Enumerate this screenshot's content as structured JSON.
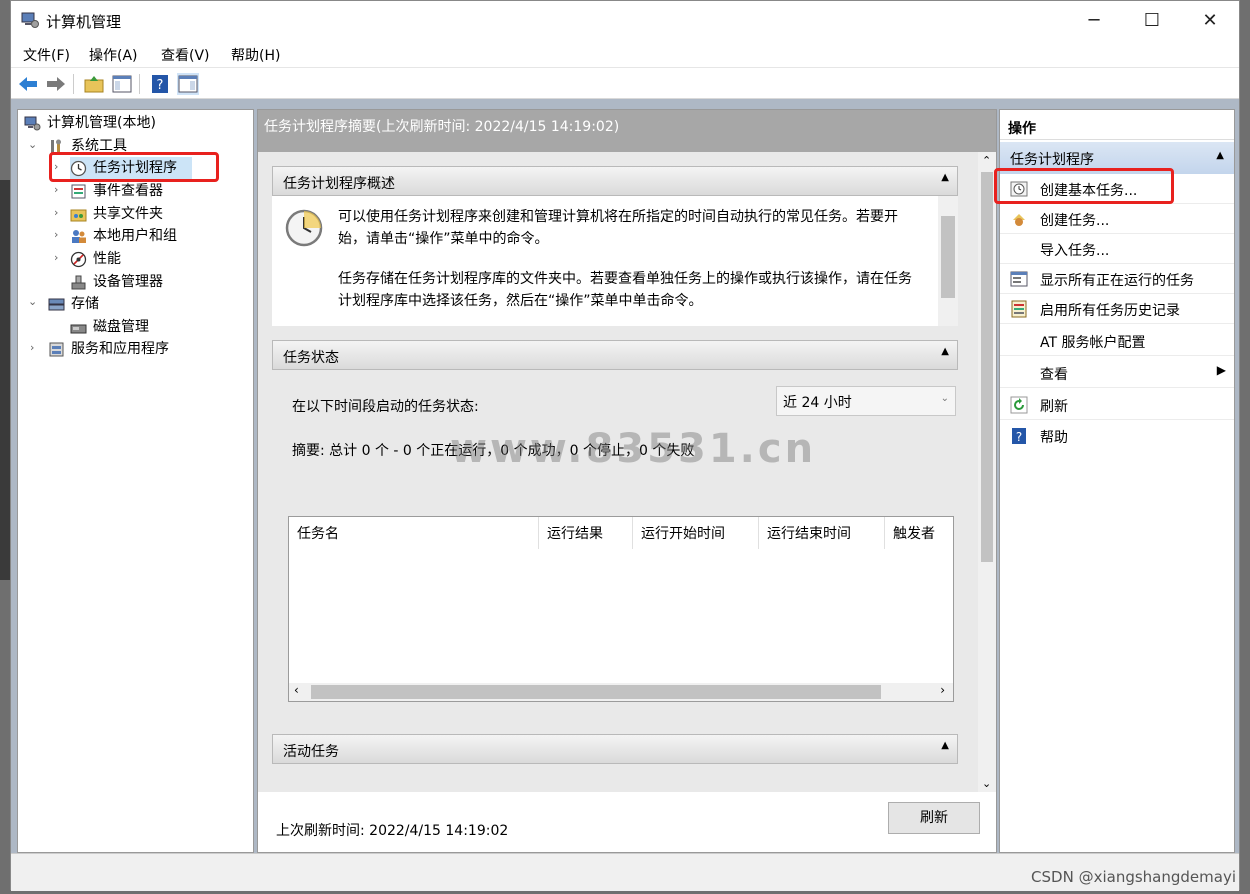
{
  "window": {
    "title": "计算机管理"
  },
  "menubar": {
    "file": "文件(F)",
    "action": "操作(A)",
    "view": "查看(V)",
    "help": "帮助(H)"
  },
  "tree": {
    "root": "计算机管理(本地)",
    "system_tools": "系统工具",
    "task_scheduler": "任务计划程序",
    "event_viewer": "事件查看器",
    "shared_folders": "共享文件夹",
    "local_users": "本地用户和组",
    "performance": "性能",
    "device_manager": "设备管理器",
    "storage": "存储",
    "disk_management": "磁盘管理",
    "services_apps": "服务和应用程序"
  },
  "center": {
    "header": "任务计划程序摘要(上次刷新时间: 2022/4/15 14:19:02)",
    "overview": {
      "title": "任务计划程序概述",
      "para1": "可以使用任务计划程序来创建和管理计算机将在所指定的时间自动执行的常见任务。若要开始，请单击“操作”菜单中的命令。",
      "para2": "任务存储在任务计划程序库的文件夹中。若要查看单独任务上的操作或执行该操作，请在任务计划程序库中选择该任务，然后在“操作”菜单中单击命令。"
    },
    "status": {
      "title": "任务状态",
      "label": "在以下时间段启动的任务状态:",
      "period": "近 24 小时",
      "summary": "摘要: 总计 0 个 - 0 个正在运行，0 个成功，0 个停止，0 个失败",
      "columns": [
        "任务名",
        "运行结果",
        "运行开始时间",
        "运行结束时间",
        "触发者"
      ]
    },
    "active": {
      "title": "活动任务"
    },
    "footer": "上次刷新时间: 2022/4/15 14:19:02",
    "refresh_button": "刷新"
  },
  "actions": {
    "title": "操作",
    "section": "任务计划程序",
    "items": [
      "创建基本任务...",
      "创建任务...",
      "导入任务...",
      "显示所有正在运行的任务",
      "启用所有任务历史记录",
      "AT 服务帐户配置",
      "查看",
      "刷新",
      "帮助"
    ]
  },
  "watermark": "www.83531.cn",
  "credit": "CSDN @xiangshangdemayi",
  "colors": {
    "highlight": "#e8211e",
    "section_blue": "#c3d5ec"
  }
}
